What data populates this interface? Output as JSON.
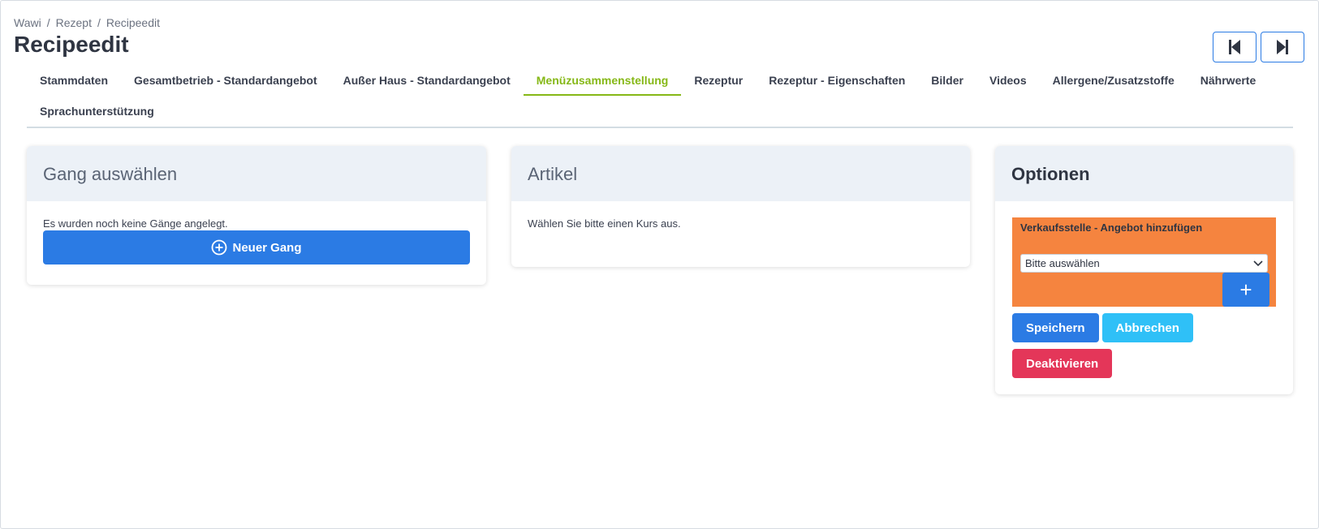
{
  "breadcrumb": [
    "Wawi",
    "Rezept",
    "Recipeedit"
  ],
  "page_title": "Recipeedit",
  "tabs": [
    {
      "label": "Stammdaten"
    },
    {
      "label": "Gesamtbetrieb - Standardangebot"
    },
    {
      "label": "Außer Haus - Standardangebot"
    },
    {
      "label": "Menüzusammenstellung",
      "active": true
    },
    {
      "label": "Rezeptur"
    },
    {
      "label": "Rezeptur - Eigenschaften"
    },
    {
      "label": "Bilder"
    },
    {
      "label": "Videos"
    },
    {
      "label": "Allergene/Zusatzstoffe"
    },
    {
      "label": "Nährwerte"
    },
    {
      "label": "Sprachunterstützung"
    }
  ],
  "gang_card": {
    "title": "Gang auswählen",
    "empty_text": "Es wurden noch keine Gänge angelegt.",
    "new_button": "Neuer Gang"
  },
  "artikel_card": {
    "title": "Artikel",
    "hint": "Wählen Sie bitte einen Kurs aus."
  },
  "options_card": {
    "title": "Optionen",
    "sales_point_label": "Verkaufsstelle - Angebot hinzufügen",
    "select_value": "Bitte auswählen",
    "add_button": "+",
    "save_button": "Speichern",
    "cancel_button": "Abbrechen",
    "deactivate_button": "Deaktivieren"
  },
  "colors": {
    "primary": "#2b7be4",
    "active_tab": "#86b817",
    "info": "#2fc0f7",
    "danger": "#e43659",
    "orange_panel": "#f5843f"
  },
  "icons": {
    "nav_first": "skip-to-start-icon",
    "nav_last": "skip-to-end-icon",
    "add_circle": "plus-circle-icon",
    "select_arrow": "chevron-down-icon"
  }
}
